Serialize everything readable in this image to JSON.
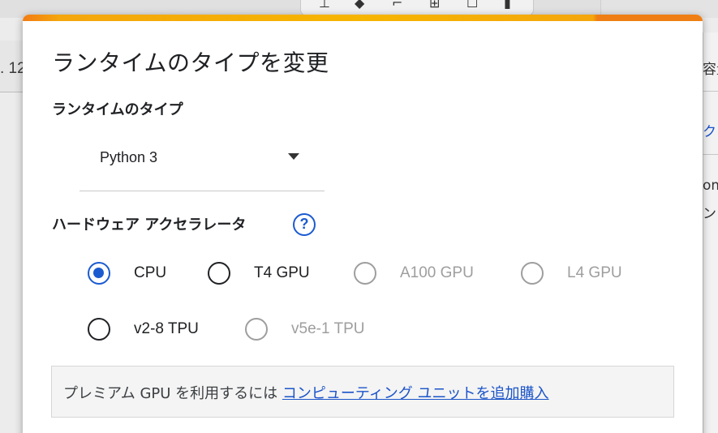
{
  "background": {
    "left_fragment": ". 12",
    "right_fragments": [
      "容量",
      "ク",
      "om",
      "ン"
    ]
  },
  "dialog": {
    "title": "ランタイムのタイプを変更",
    "runtime_type": {
      "label": "ランタイムのタイプ",
      "selected": "Python 3"
    },
    "hardware_accelerator": {
      "label": "ハードウェア アクセラレータ",
      "help_glyph": "?",
      "options": [
        {
          "label": "CPU",
          "checked": true,
          "enabled": true
        },
        {
          "label": "T4 GPU",
          "checked": false,
          "enabled": true
        },
        {
          "label": "A100 GPU",
          "checked": false,
          "enabled": false
        },
        {
          "label": "L4 GPU",
          "checked": false,
          "enabled": false
        },
        {
          "label": "v2-8 TPU",
          "checked": false,
          "enabled": true
        },
        {
          "label": "v5e-1 TPU",
          "checked": false,
          "enabled": false
        }
      ]
    },
    "premium_info": {
      "text": "プレミアム GPU を利用するには ",
      "link": "コンピューティング ユニットを追加購入"
    }
  },
  "colors": {
    "accent": "#1a5bd0",
    "link": "#1a53c9",
    "top_bar_orange": "#f37c15",
    "top_bar_yellow": "#f6b500"
  }
}
